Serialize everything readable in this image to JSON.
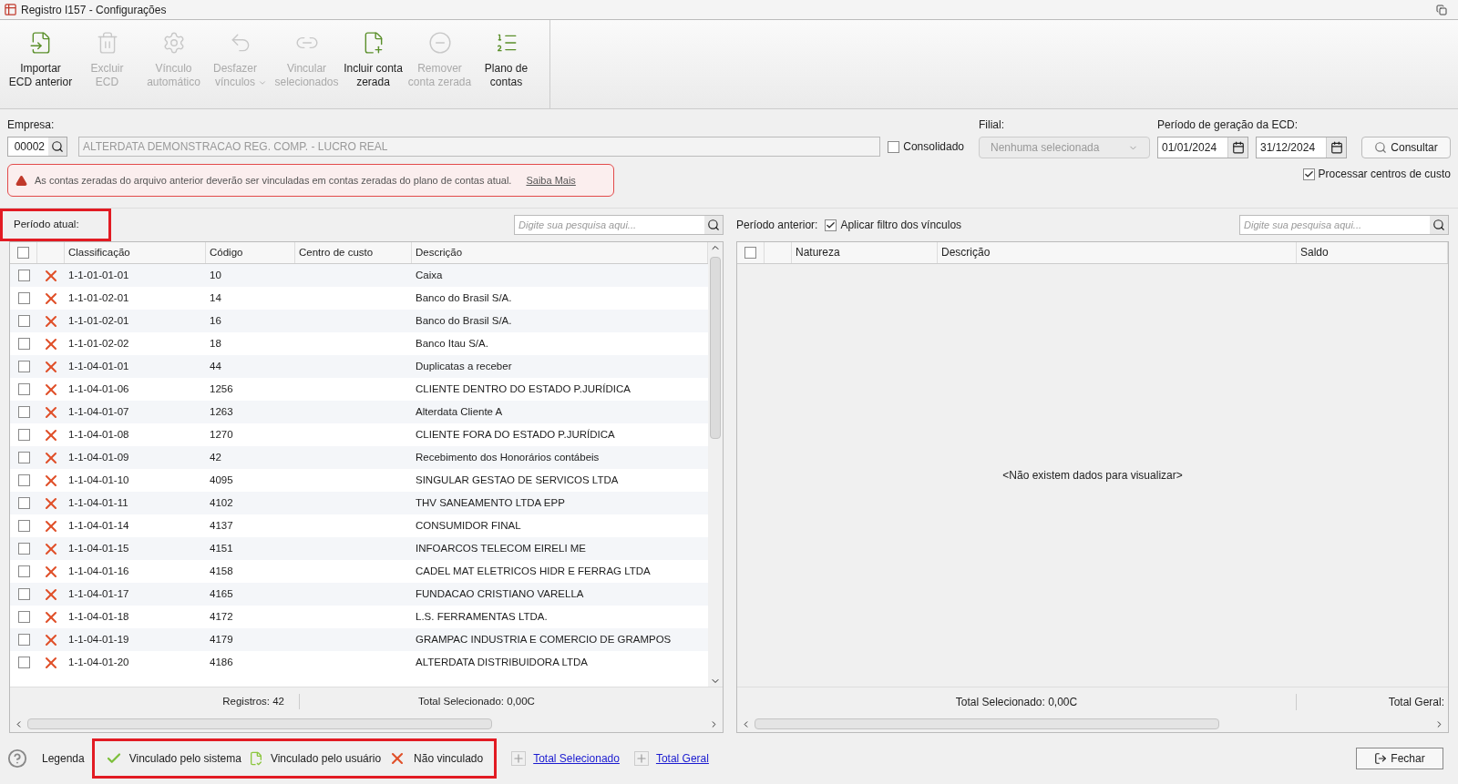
{
  "window": {
    "title": "Registro I157 - Configurações"
  },
  "toolbar": [
    {
      "label_lines": [
        "Importar",
        "ECD anterior"
      ],
      "kind": "import",
      "enabled": true,
      "dropdown": false
    },
    {
      "label_lines": [
        "Excluir",
        "ECD"
      ],
      "kind": "delete",
      "enabled": false,
      "dropdown": false
    },
    {
      "label_lines": [
        "Vínculo",
        "automático"
      ],
      "kind": "auto",
      "enabled": false,
      "dropdown": false
    },
    {
      "label_lines": [
        "Desfazer",
        "vínculos"
      ],
      "kind": "undo",
      "enabled": false,
      "dropdown": true
    },
    {
      "label_lines": [
        "Vincular",
        "selecionados"
      ],
      "kind": "link",
      "enabled": false,
      "dropdown": false
    },
    {
      "label_lines": [
        "Incluir conta",
        "zerada"
      ],
      "kind": "add",
      "enabled": true,
      "dropdown": false
    },
    {
      "label_lines": [
        "Remover",
        "conta zerada"
      ],
      "kind": "remove",
      "enabled": false,
      "dropdown": false
    },
    {
      "label_lines": [
        "Plano de",
        "contas"
      ],
      "kind": "list",
      "enabled": true,
      "dropdown": false
    }
  ],
  "form": {
    "empresa_label": "Empresa:",
    "empresa_code": "00002",
    "empresa_name": "ALTERDATA DEMONSTRACAO REG. COMP. - LUCRO REAL",
    "consolidado": {
      "label": "Consolidado",
      "checked": false
    },
    "filial_label": "Filial:",
    "filial_value": "Nenhuma selecionada",
    "periodo_label": "Período de geração da ECD:",
    "date_from": "01/01/2024",
    "date_to": "31/12/2024",
    "consultar": "Consultar",
    "processar": {
      "label": "Processar centros de custo",
      "checked": true
    }
  },
  "alert": {
    "text": "As contas zeradas do arquivo anterior deverão ser vinculadas em contas zeradas do plano de contas atual.",
    "link": "Saiba Mais"
  },
  "left": {
    "title": "Período atual:",
    "highlighted": true,
    "search_placeholder": "Digite sua pesquisa aqui...",
    "select_all": {
      "checked": false
    },
    "columns": [
      "Classificação",
      "Código",
      "Centro de custo",
      "Descrição"
    ],
    "rows": [
      {
        "kind": "none",
        "classificacao": "1-1-01-01-01",
        "codigo": "10",
        "descricao": "Caixa",
        "checked": false
      },
      {
        "kind": "none",
        "classificacao": "1-1-01-02-01",
        "codigo": "14",
        "descricao": "Banco do Brasil S/A.",
        "checked": false
      },
      {
        "kind": "none",
        "classificacao": "1-1-01-02-01",
        "codigo": "16",
        "descricao": "Banco do Brasil S/A.",
        "checked": false
      },
      {
        "kind": "none",
        "classificacao": "1-1-01-02-02",
        "codigo": "18",
        "descricao": "Banco Itau S/A.",
        "checked": false
      },
      {
        "kind": "none",
        "classificacao": "1-1-04-01-01",
        "codigo": "44",
        "descricao": "Duplicatas a receber",
        "checked": false
      },
      {
        "kind": "none",
        "classificacao": "1-1-04-01-06",
        "codigo": "1256",
        "descricao": "CLIENTE DENTRO DO ESTADO P.JURÍDICA",
        "checked": false
      },
      {
        "kind": "none",
        "classificacao": "1-1-04-01-07",
        "codigo": "1263",
        "descricao": "Alterdata Cliente A",
        "checked": false
      },
      {
        "kind": "none",
        "classificacao": "1-1-04-01-08",
        "codigo": "1270",
        "descricao": "CLIENTE FORA DO ESTADO P.JURÍDICA",
        "checked": false
      },
      {
        "kind": "none",
        "classificacao": "1-1-04-01-09",
        "codigo": "42",
        "descricao": "Recebimento dos Honorários contábeis",
        "checked": false
      },
      {
        "kind": "none",
        "classificacao": "1-1-04-01-10",
        "codigo": "4095",
        "descricao": "SINGULAR GESTAO DE SERVICOS LTDA",
        "checked": false
      },
      {
        "kind": "none",
        "classificacao": "1-1-04-01-11",
        "codigo": "4102",
        "descricao": "THV SANEAMENTO LTDA EPP",
        "checked": false
      },
      {
        "kind": "none",
        "classificacao": "1-1-04-01-14",
        "codigo": "4137",
        "descricao": "CONSUMIDOR FINAL",
        "checked": false
      },
      {
        "kind": "none",
        "classificacao": "1-1-04-01-15",
        "codigo": "4151",
        "descricao": "INFOARCOS TELECOM EIRELI ME",
        "checked": false
      },
      {
        "kind": "none",
        "classificacao": "1-1-04-01-16",
        "codigo": "4158",
        "descricao": "CADEL MAT ELETRICOS HIDR E FERRAG LTDA",
        "checked": false
      },
      {
        "kind": "none",
        "classificacao": "1-1-04-01-17",
        "codigo": "4165",
        "descricao": "FUNDACAO CRISTIANO VARELLA",
        "checked": false
      },
      {
        "kind": "none",
        "classificacao": "1-1-04-01-18",
        "codigo": "4172",
        "descricao": "L.S. FERRAMENTAS LTDA.",
        "checked": false
      },
      {
        "kind": "none",
        "classificacao": "1-1-04-01-19",
        "codigo": "4179",
        "descricao": "GRAMPAC INDUSTRIA E COMERCIO DE GRAMPOS",
        "checked": false
      },
      {
        "kind": "none",
        "classificacao": "1-1-04-01-20",
        "codigo": "4186",
        "descricao": "ALTERDATA DISTRIBUIDORA LTDA",
        "checked": false
      }
    ],
    "footer": [
      "Registros: 42",
      "Total Selecionado: 0,00C"
    ]
  },
  "right": {
    "title": "Período anterior:",
    "filter": {
      "label": "Aplicar filtro dos vínculos",
      "checked": true
    },
    "search_placeholder": "Digite sua pesquisa aqui...",
    "select_all": {
      "checked": false
    },
    "columns": [
      "Natureza",
      "Descrição",
      "Saldo"
    ],
    "empty": "<Não existem dados para visualizar>",
    "footer": [
      "Total Selecionado: 0,00C",
      "Total Geral:"
    ]
  },
  "bottom": {
    "legend_label": "Legenda",
    "highlighted": true,
    "legend": [
      {
        "kind": "system",
        "label": "Vinculado pelo sistema"
      },
      {
        "kind": "user",
        "label": "Vinculado pelo usuário"
      },
      {
        "kind": "none",
        "label": "Não vinculado"
      }
    ],
    "links": [
      "Total Selecionado",
      "Total Geral"
    ],
    "close": "Fechar"
  }
}
